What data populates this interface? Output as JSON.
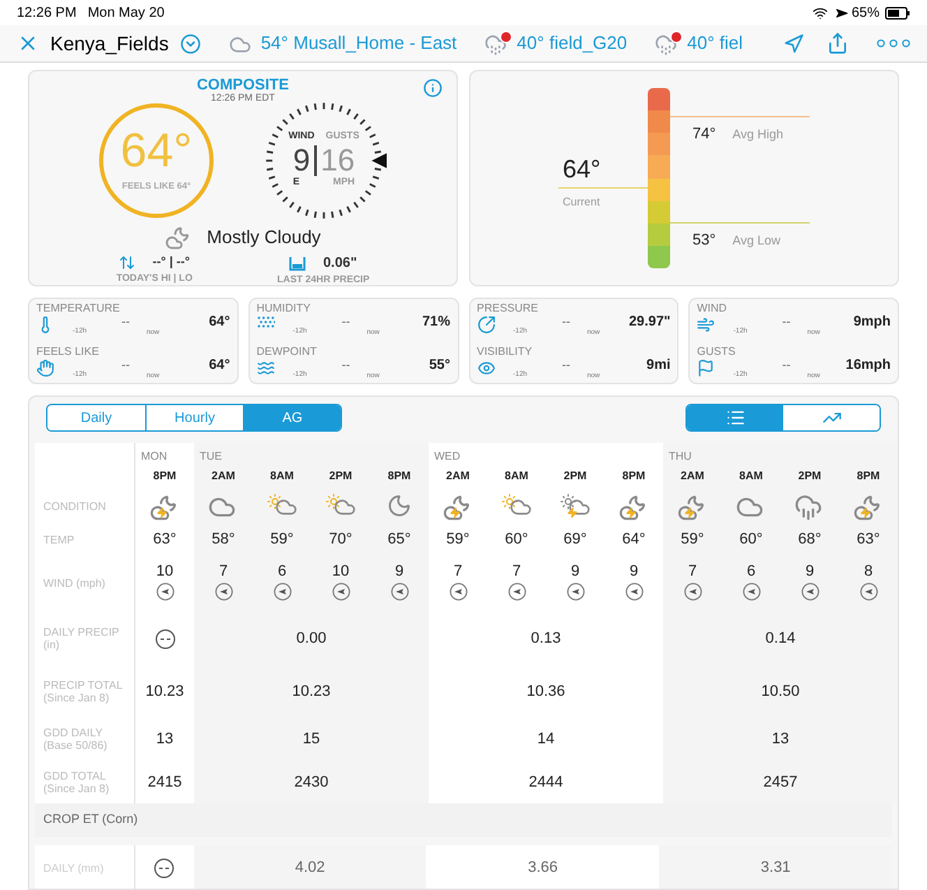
{
  "status_bar": {
    "time": "12:26 PM",
    "date": "Mon May 20",
    "battery": "65%"
  },
  "nav": {
    "title": "Kenya_Fields",
    "locations": [
      {
        "temp": "54°",
        "name": "Musall_Home - East",
        "kind": "cloud",
        "alert": false
      },
      {
        "temp": "40°",
        "name": "field_G20",
        "kind": "drizzle",
        "alert": true
      },
      {
        "temp": "40°",
        "name": "fiel",
        "kind": "drizzle",
        "alert": true
      }
    ]
  },
  "composite": {
    "title": "COMPOSITE",
    "time": "12:26 PM EDT",
    "temp": "64°",
    "feels_like": "FEELS LIKE 64°",
    "wind_label": "WIND",
    "gusts_label": "GUSTS",
    "wind": "9",
    "gusts": "16",
    "direction": "E",
    "unit": "MPH",
    "condition": "Mostly Cloudy",
    "hi_lo": "--° | --°",
    "hi_lo_label": "TODAY'S HI | LO",
    "precip": "0.06\"",
    "precip_label": "LAST 24HR PRECIP"
  },
  "temp_range": {
    "current": "64°",
    "current_label": "Current",
    "avg_high": "74°",
    "avg_high_label": "Avg High",
    "avg_low": "53°",
    "avg_low_label": "Avg Low"
  },
  "metric_cards": [
    {
      "metrics": [
        {
          "kind": "temperature",
          "label": "TEMPERATURE",
          "previous": "--",
          "previous_label": "-12h",
          "value": "64°",
          "current_label": "now"
        },
        {
          "kind": "feels",
          "label": "FEELS LIKE",
          "previous": "--",
          "previous_label": "-12h",
          "value": "64°",
          "current_label": "now"
        }
      ]
    },
    {
      "metrics": [
        {
          "kind": "humidity",
          "label": "HUMIDITY",
          "previous": "--",
          "previous_label": "-12h",
          "value": "71%",
          "current_label": "now"
        },
        {
          "kind": "dewpoint",
          "label": "DEWPOINT",
          "previous": "--",
          "previous_label": "-12h",
          "value": "55°",
          "current_label": "now"
        }
      ]
    },
    {
      "metrics": [
        {
          "kind": "pressure",
          "label": "PRESSURE",
          "previous": "--",
          "previous_label": "-12h",
          "value": "29.97\"",
          "current_label": "now"
        },
        {
          "kind": "visibility",
          "label": "VISIBILITY",
          "previous": "--",
          "previous_label": "-12h",
          "value": "9mi",
          "current_label": "now"
        }
      ]
    },
    {
      "metrics": [
        {
          "kind": "wind",
          "label": "WIND",
          "previous": "--",
          "previous_label": "-12h",
          "value": "9mph",
          "current_label": "now"
        },
        {
          "kind": "gusts",
          "label": "GUSTS",
          "previous": "--",
          "previous_label": "-12h",
          "value": "16mph",
          "current_label": "now"
        }
      ]
    }
  ],
  "tabs": [
    {
      "label": "Daily",
      "selected": false
    },
    {
      "label": "Hourly",
      "selected": false
    },
    {
      "label": "AG",
      "selected": true
    }
  ],
  "view_toggle": [
    {
      "kind": "list",
      "selected": true
    },
    {
      "kind": "chart",
      "selected": false
    }
  ],
  "row_labels": {
    "condition": "CONDITION",
    "temp": "TEMP",
    "wind": "WIND (mph)",
    "daily_precip": "DAILY PRECIP (in)",
    "precip_total": "PRECIP TOTAL (Since Jan 8)",
    "gdd_daily": "GDD DAILY (Base 50/86)",
    "gdd_total": "GDD TOTAL (Since Jan 8)",
    "crop_section": "CROP ET (Corn)",
    "crop_daily": "DAILY (mm)"
  },
  "days": [
    {
      "day": "MON",
      "hours": [
        {
          "time": "8PM",
          "kind": "night_storm",
          "temp": "63°",
          "wind": "10"
        }
      ],
      "precip_total": "10.23",
      "gdd_daily": "13",
      "gdd_total": "2415"
    },
    {
      "day": "TUE",
      "hours": [
        {
          "time": "2AM",
          "kind": "cloudy",
          "temp": "58°",
          "wind": "7"
        },
        {
          "time": "8AM",
          "kind": "partly_sunny",
          "temp": "59°",
          "wind": "6"
        },
        {
          "time": "2PM",
          "kind": "partly_sunny",
          "temp": "70°",
          "wind": "10"
        },
        {
          "time": "8PM",
          "kind": "moon",
          "temp": "65°",
          "wind": "9"
        }
      ],
      "daily_precip": "0.00",
      "precip_total": "10.23",
      "gdd_daily": "15",
      "gdd_total": "2430",
      "crop_daily": "4.02"
    },
    {
      "day": "WED",
      "hours": [
        {
          "time": "2AM",
          "kind": "night_storm",
          "temp": "59°",
          "wind": "7"
        },
        {
          "time": "8AM",
          "kind": "partly_sunny",
          "temp": "60°",
          "wind": "7"
        },
        {
          "time": "2PM",
          "kind": "sun_storm",
          "temp": "69°",
          "wind": "9"
        },
        {
          "time": "8PM",
          "kind": "night_storm",
          "temp": "64°",
          "wind": "9"
        }
      ],
      "daily_precip": "0.13",
      "precip_total": "10.36",
      "gdd_daily": "14",
      "gdd_total": "2444",
      "crop_daily": "3.66"
    },
    {
      "day": "THU",
      "hours": [
        {
          "time": "2AM",
          "kind": "night_storm",
          "temp": "59°",
          "wind": "7"
        },
        {
          "time": "8AM",
          "kind": "cloudy",
          "temp": "60°",
          "wind": "6"
        },
        {
          "time": "2PM",
          "kind": "rain",
          "temp": "68°",
          "wind": "9"
        },
        {
          "time": "8PM",
          "kind": "night_storm",
          "temp": "63°",
          "wind": "8"
        }
      ],
      "daily_precip": "0.14",
      "precip_total": "10.50",
      "gdd_daily": "13",
      "gdd_total": "2457",
      "crop_daily": "3.31"
    }
  ]
}
